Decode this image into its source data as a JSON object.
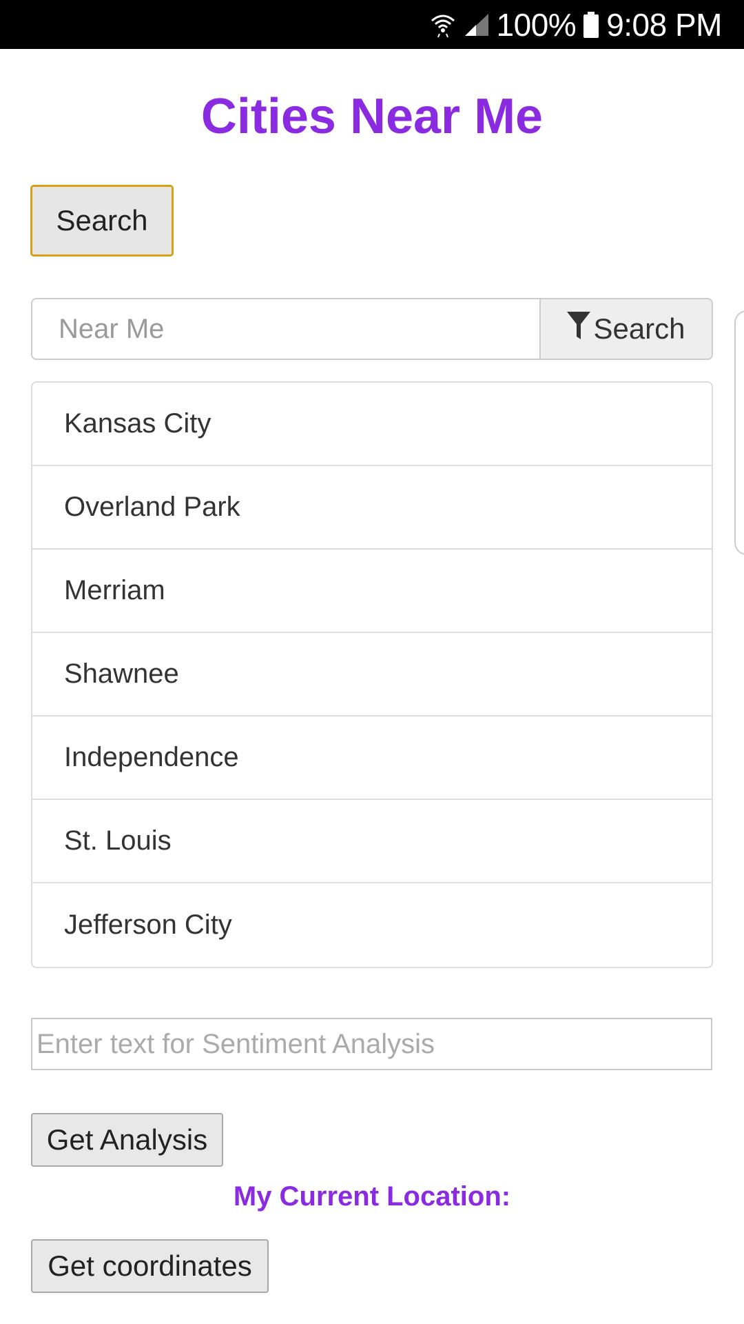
{
  "status_bar": {
    "battery": "100%",
    "time": "9:08 PM",
    "icons": [
      "wifi-icon",
      "signal-icon",
      "battery-icon"
    ]
  },
  "app": {
    "title": "Cities Near Me",
    "search_button_label": "Search"
  },
  "filter": {
    "placeholder": "Near Me",
    "button_label": "Search",
    "button_icon": "filter-icon"
  },
  "cities": [
    "Kansas City",
    "Overland Park",
    "Merriam",
    "Shawnee",
    "Independence",
    "St. Louis",
    "Jefferson City"
  ],
  "sentiment": {
    "placeholder": "Enter text for Sentiment Analysis",
    "button_label": "Get Analysis"
  },
  "location": {
    "heading": "My Current Location:",
    "button_label": "Get coordinates"
  },
  "colors": {
    "accent": "#8a2be2",
    "focus_border": "#d4a017",
    "status_bar": "#000000"
  }
}
